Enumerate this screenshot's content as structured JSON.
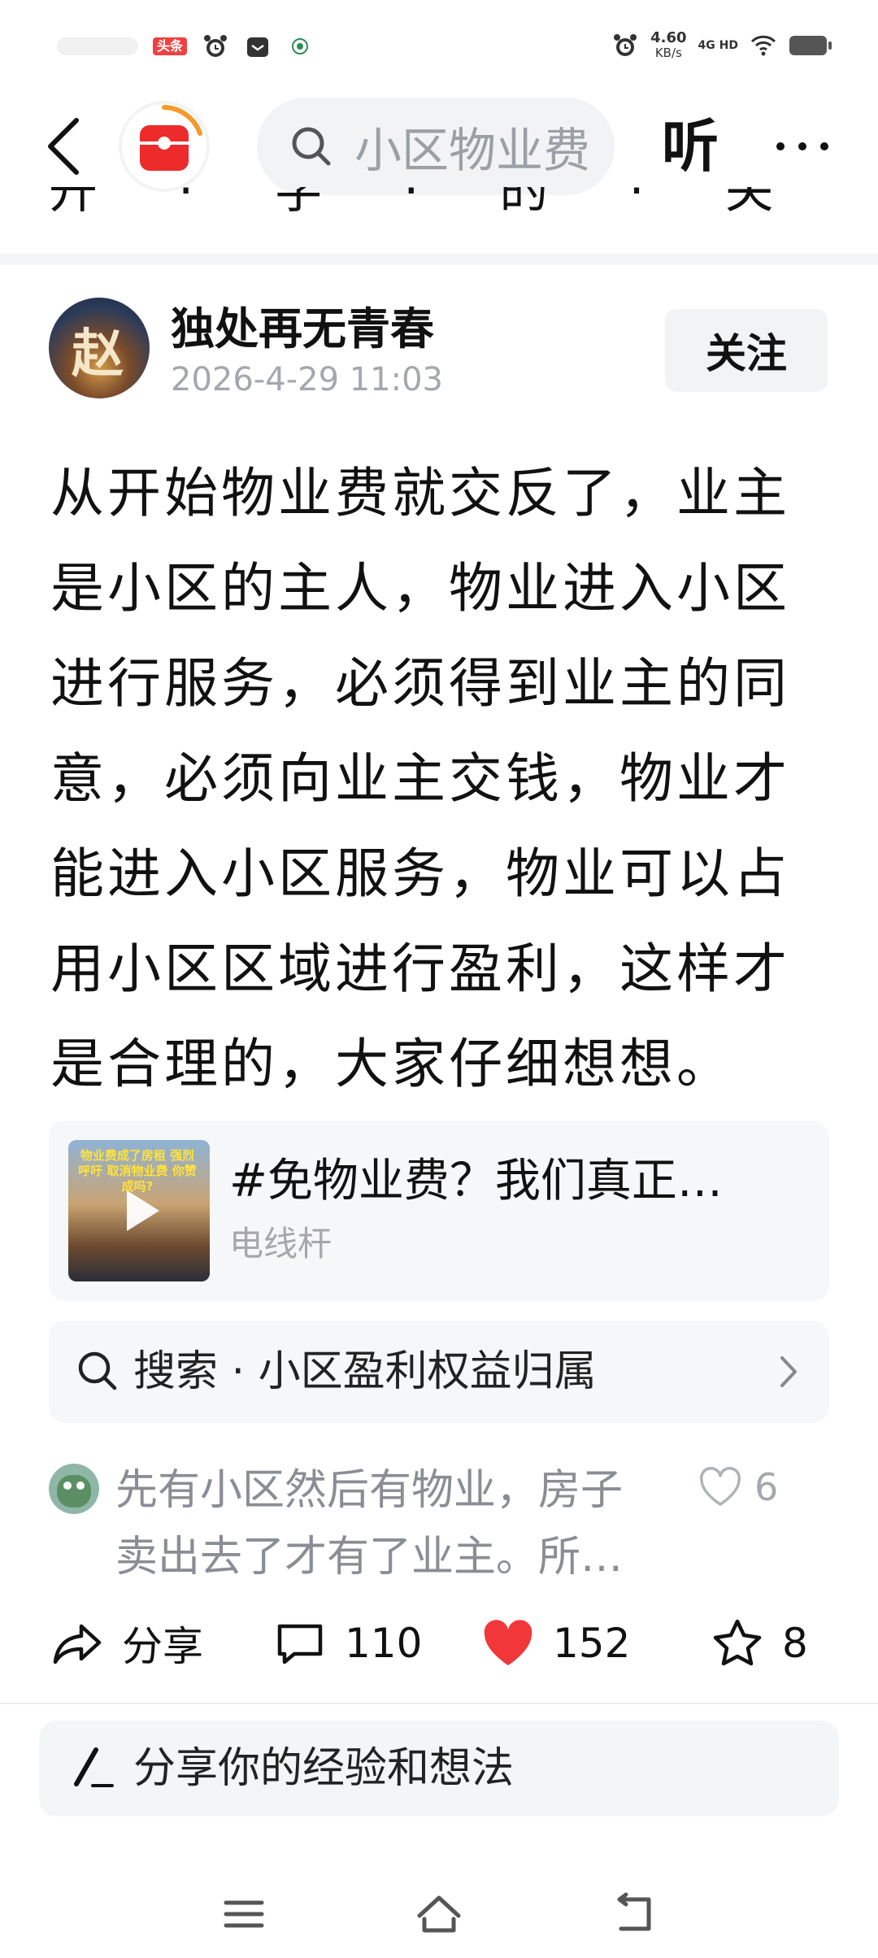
{
  "status_bar": {
    "badge": "头条",
    "speed_value": "4.60",
    "speed_unit": "KB/s",
    "network": "4G HD"
  },
  "nav": {
    "search_text": "小区物业费",
    "listen_label": "听"
  },
  "clipped_previous_text": "开 · 字 · 的 · 关 · 一 · 题",
  "post": {
    "author_name": "独处再无青春",
    "avatar_char": "赵",
    "time": "2026-4-29 11:03",
    "follow_label": "关注",
    "body": "从开始物业费就交反了，业主是小区的主人，物业进入小区进行服务，必须得到业主的同意，必须向业主交钱，物业才能进入小区服务，物业可以占用小区区域进行盈利，这样才是合理的，大家仔细想想。"
  },
  "video_card": {
    "thumb_caption": "物业费成了房租 强烈呼吁 取消物业费 你赞成吗?",
    "title": "#免物业费？我们真正…",
    "source": "电线杆"
  },
  "related_search": {
    "text": "搜索 · 小区盈利权益归属"
  },
  "top_comment": {
    "text": "先有小区然后有物业，房子卖出去了才有了业主。所…",
    "likes": "6"
  },
  "actions": {
    "share_label": "分享",
    "comments": "110",
    "likes": "152",
    "favorites": "8"
  },
  "composer": {
    "placeholder": "分享你的经验和想法"
  },
  "colors": {
    "accent_red": "#f2373a",
    "muted_text": "#a4a7ad",
    "card_bg": "#f6f7f9"
  }
}
